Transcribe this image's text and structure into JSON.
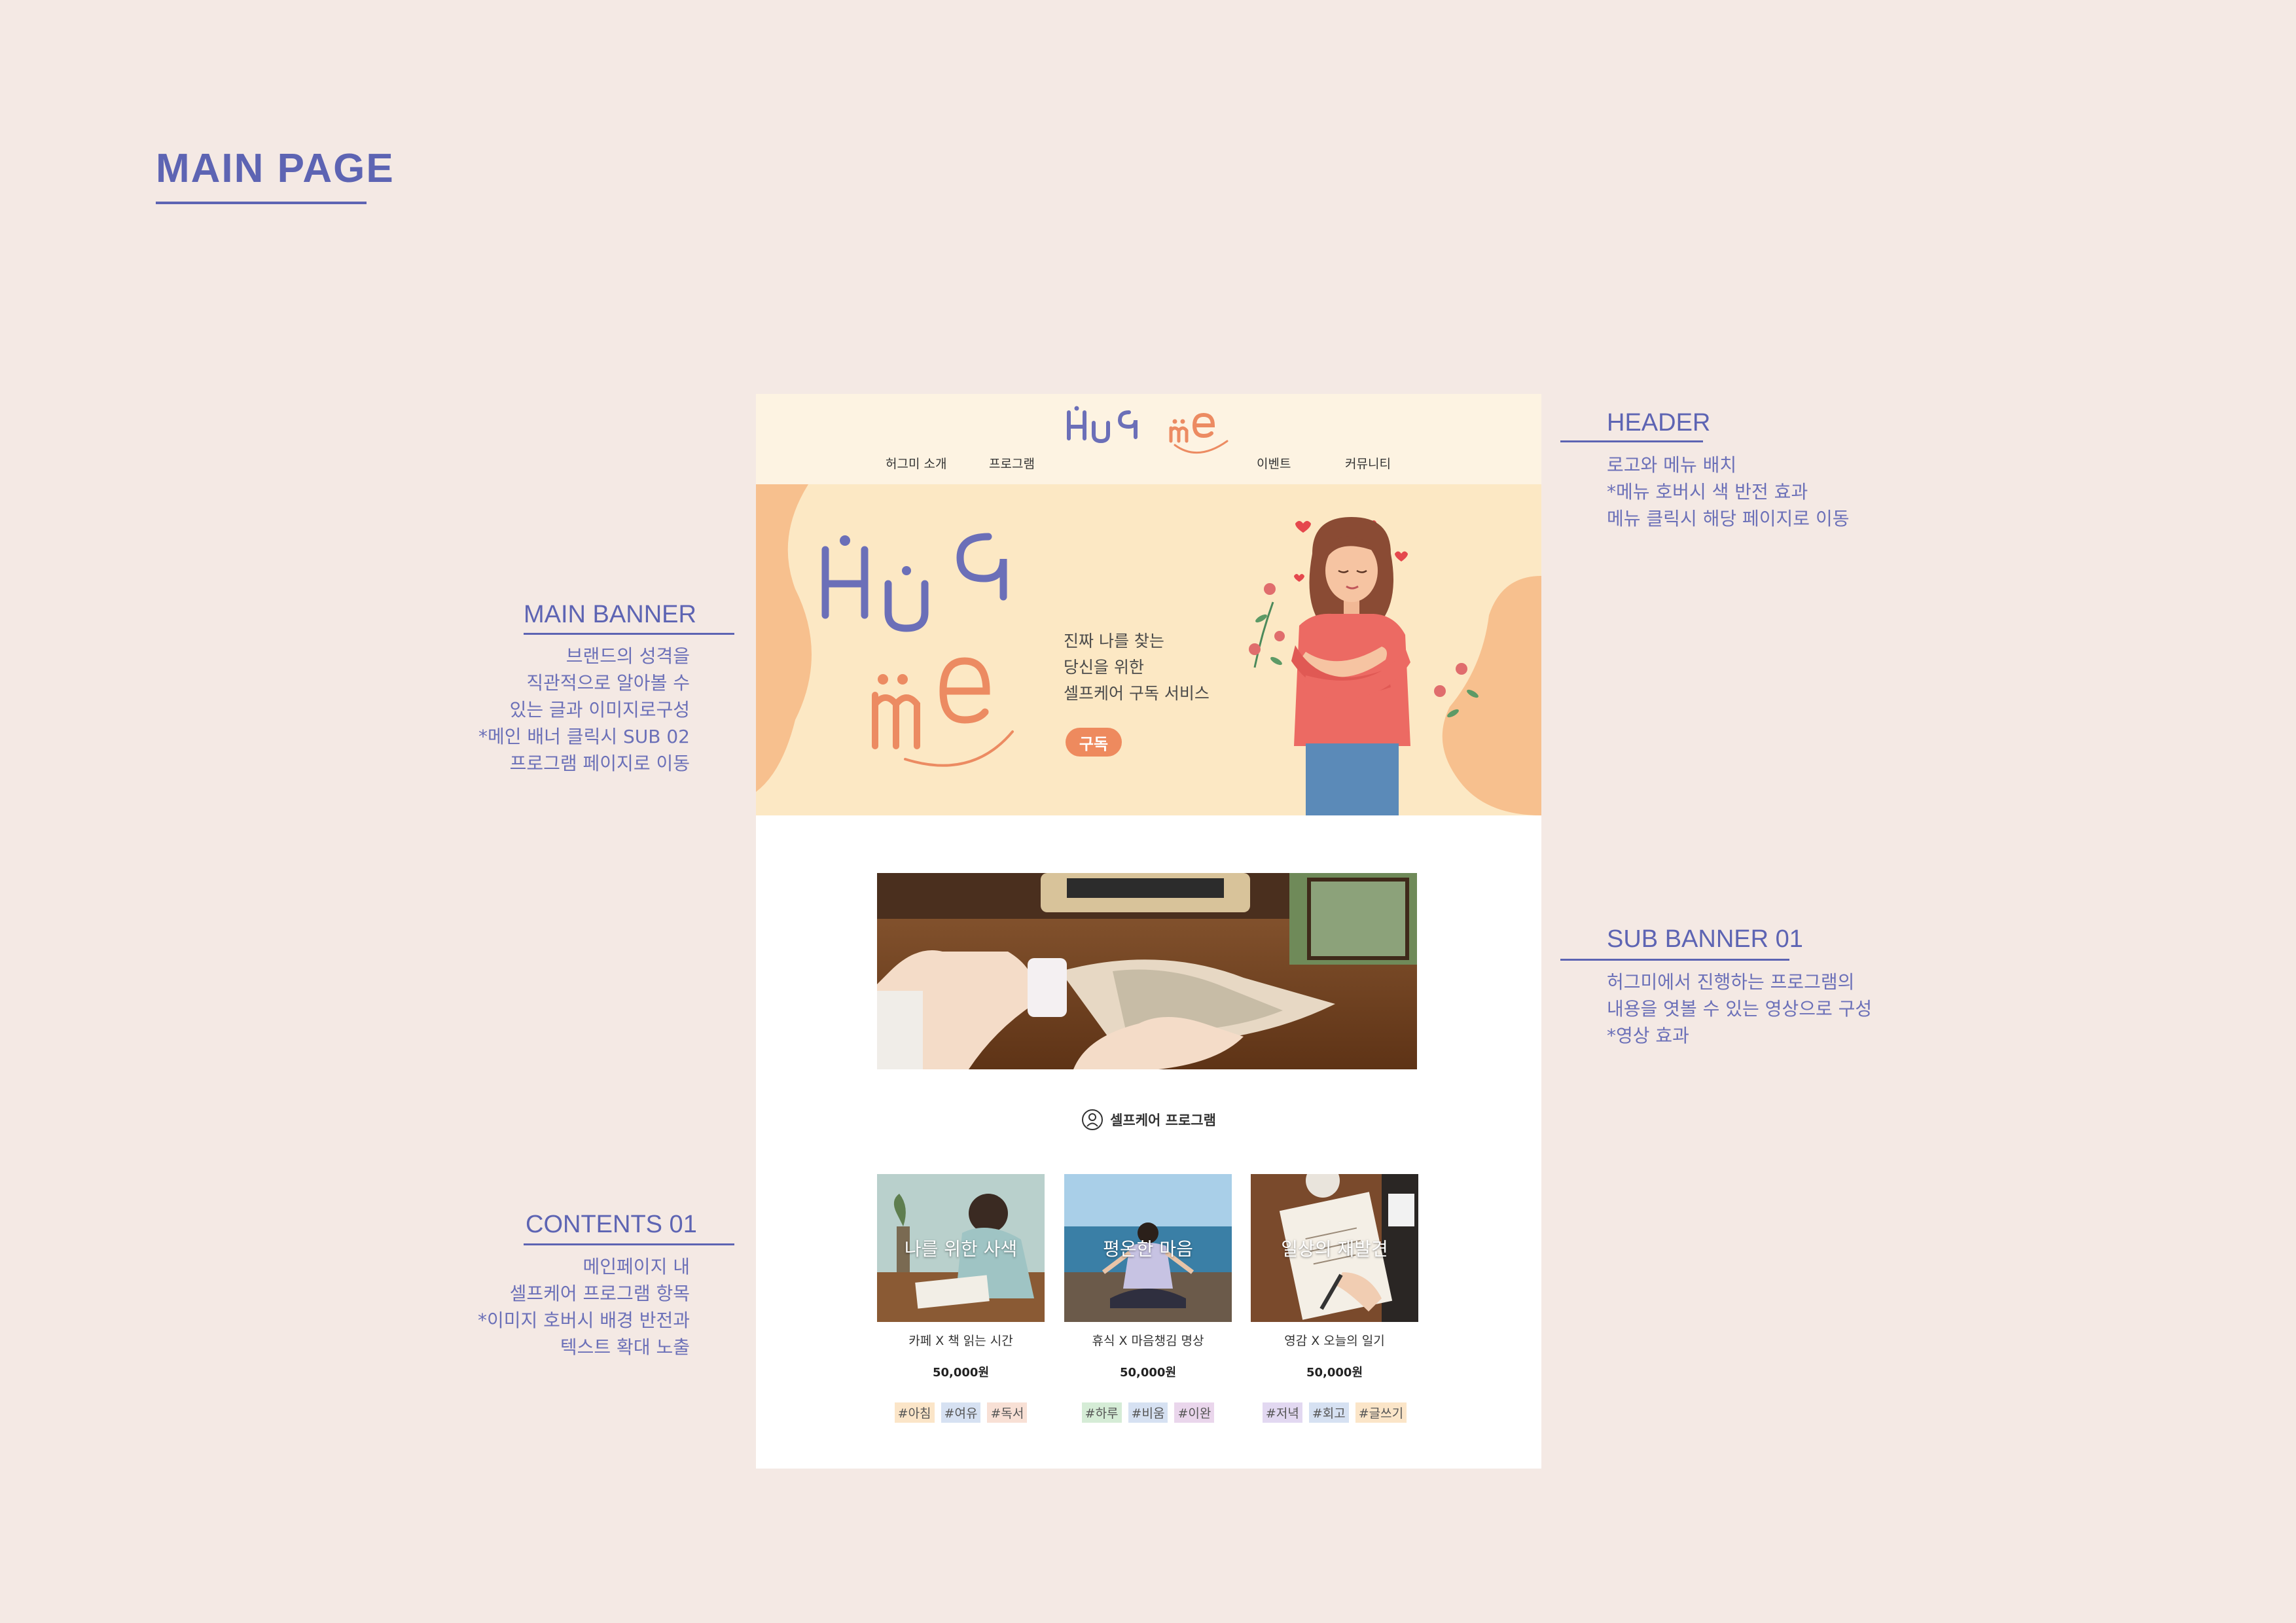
{
  "board": {
    "title": "MAIN PAGE"
  },
  "annotations": {
    "header": {
      "title": "HEADER",
      "lines": [
        "로고와 메뉴 배치",
        "*메뉴 호버시 색 반전 효과",
        "메뉴 클릭시 해당 페이지로 이동"
      ]
    },
    "main_banner": {
      "title": "MAIN BANNER",
      "lines": [
        "브랜드의 성격을",
        "직관적으로 알아볼 수",
        "있는 글과 이미지로구성",
        "*메인 배너 클릭시 SUB 02",
        "프로그램 페이지로 이동"
      ]
    },
    "sub_banner": {
      "title": "SUB BANNER 01",
      "lines": [
        "허그미에서 진행하는 프로그램의",
        "내용을 엿볼 수 있는 영상으로 구성",
        "*영상 효과"
      ]
    },
    "contents": {
      "title": "CONTENTS 01",
      "lines": [
        "메인페이지 내",
        "셀프케어 프로그램 항목",
        "*이미지 호버시 배경 반전과",
        "텍스트 확대 노출"
      ]
    }
  },
  "site": {
    "logo_text": "Hug me",
    "nav": [
      "허그미 소개",
      "프로그램",
      "이벤트",
      "커뮤니티"
    ],
    "banner": {
      "tagline": [
        "진짜 나를 찾는",
        "당신을 위한",
        "셀프케어 구독 서비스"
      ],
      "cta": "구독"
    },
    "section_title": "셀프케어 프로그램",
    "cards": [
      {
        "overlay": "나를 위한 사색",
        "name": "카페 X 책 읽는 시간",
        "price": "50,000원",
        "tags": [
          "#아침",
          "#여유",
          "#독서"
        ]
      },
      {
        "overlay": "평온한 마음",
        "name": "휴식 X 마음챙김 명상",
        "price": "50,000원",
        "tags": [
          "#하루",
          "#비움",
          "#이완"
        ]
      },
      {
        "overlay": "일상의 재발견",
        "name": "영감 X 오늘의 일기",
        "price": "50,000원",
        "tags": [
          "#저녁",
          "#회고",
          "#글쓰기"
        ]
      }
    ]
  },
  "colors": {
    "accent": "#5d64b3",
    "logo_purple": "#6b6fb8",
    "logo_orange": "#ec8b62",
    "header_bg": "#fdf3e2",
    "banner_bg": "#fce8c4",
    "page_bg": "#f4e9e4"
  }
}
